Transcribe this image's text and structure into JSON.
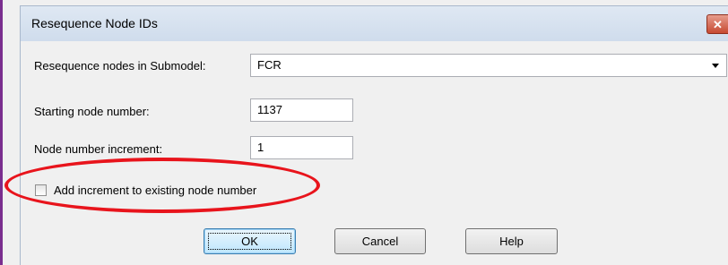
{
  "dialog": {
    "title": "Resequence Node IDs",
    "close_glyph": "✕"
  },
  "fields": {
    "submodel_label": "Resequence nodes in Submodel:",
    "submodel_value": "FCR",
    "start_label": "Starting node number:",
    "start_value": "1137",
    "increment_label": "Node number increment:",
    "increment_value": "1"
  },
  "option": {
    "add_increment_label": "Add increment to existing node number",
    "add_increment_checked": false
  },
  "buttons": {
    "ok": "OK",
    "cancel": "Cancel",
    "help": "Help"
  },
  "colors": {
    "annotation": "#e8141c",
    "title_bar": "#dfe8f3",
    "close_button": "#c74a32"
  },
  "icons": {
    "close": "close-icon",
    "dropdown": "chevron-down-icon"
  }
}
